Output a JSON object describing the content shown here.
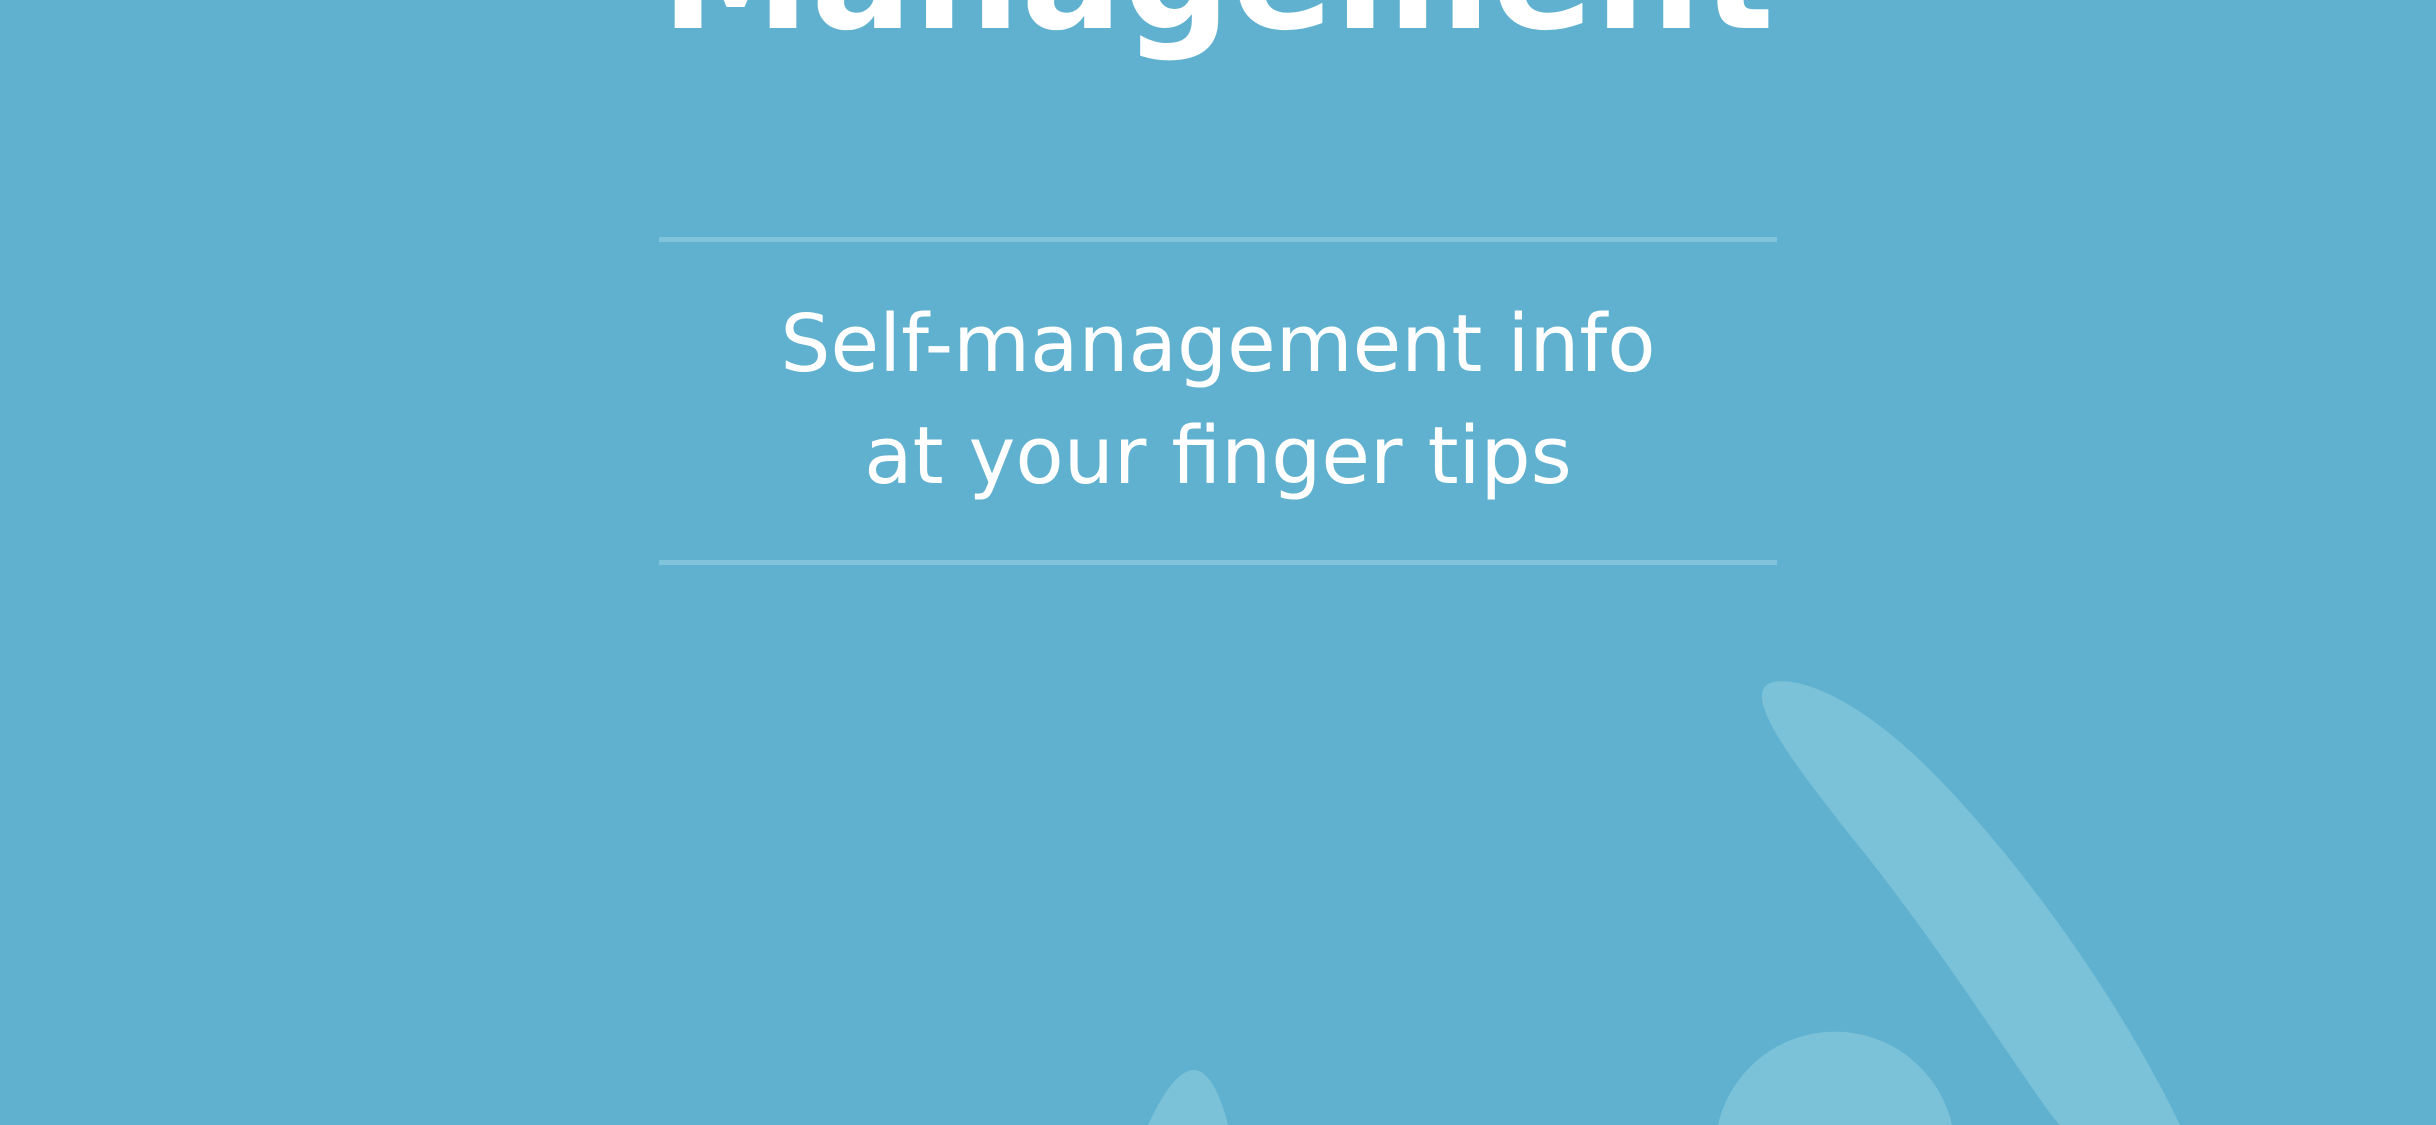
{
  "splash": {
    "title": "Management",
    "tagline": {
      "line1": "Self-management info",
      "line2": "at your finger tips"
    }
  },
  "colors": {
    "background": "#60b1cf",
    "divider": "#82c3dc",
    "illustration": "#7bc2d9",
    "text": "#ffffff"
  }
}
